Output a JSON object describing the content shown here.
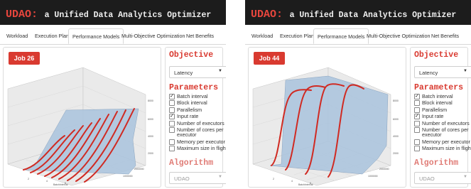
{
  "panels": [
    {
      "brand": "UDAO:",
      "subtitle": "a Unified Data Analytics Optimizer",
      "tabs": [
        "Workload",
        "Execution Plan",
        "Performance Models",
        "Multi-Objective Optimization",
        "Net Benefits"
      ],
      "active_tab": "Performance Models",
      "job_label": "Job 26",
      "objective": {
        "title": "Objective",
        "selected": "Latency"
      },
      "parameters": {
        "title": "Parameters",
        "items": [
          {
            "label": "Batch interval",
            "checked": true
          },
          {
            "label": "Block interval",
            "checked": false
          },
          {
            "label": "Parallelism",
            "checked": false
          },
          {
            "label": "Input rate",
            "checked": true
          },
          {
            "label": "Number of executors",
            "checked": false
          },
          {
            "label": "Number of cores per executor",
            "checked": false
          },
          {
            "label": "Memory per executor",
            "checked": false
          },
          {
            "label": "Maximum size in flight",
            "checked": false
          }
        ]
      },
      "algorithm": {
        "title": "Algorithm",
        "selected": "UDAO"
      }
    },
    {
      "brand": "UDAO:",
      "subtitle": "a Unified Data Analytics Optimizer",
      "tabs": [
        "Workload",
        "Execution Plan",
        "Performance Models",
        "Multi-Objective Optimization",
        "Net Benefits"
      ],
      "active_tab": "Performance Models",
      "job_label": "Job 44",
      "objective": {
        "title": "Objective",
        "selected": "Latency"
      },
      "parameters": {
        "title": "Parameters",
        "items": [
          {
            "label": "Batch interval",
            "checked": true
          },
          {
            "label": "Block interval",
            "checked": false
          },
          {
            "label": "Parallelism",
            "checked": false
          },
          {
            "label": "Input rate",
            "checked": true
          },
          {
            "label": "Number of executors",
            "checked": false
          },
          {
            "label": "Number of cores per executor",
            "checked": false
          },
          {
            "label": "Memory per executor",
            "checked": false
          },
          {
            "label": "Maximum size in flight",
            "checked": false
          }
        ]
      },
      "algorithm": {
        "title": "Algorithm",
        "selected": "UDAO"
      }
    }
  ],
  "colors": {
    "accent": "#d93a30",
    "title_bar": "#1c1c1c",
    "surface": "#a9c3dd",
    "curve": "#d02a22"
  }
}
